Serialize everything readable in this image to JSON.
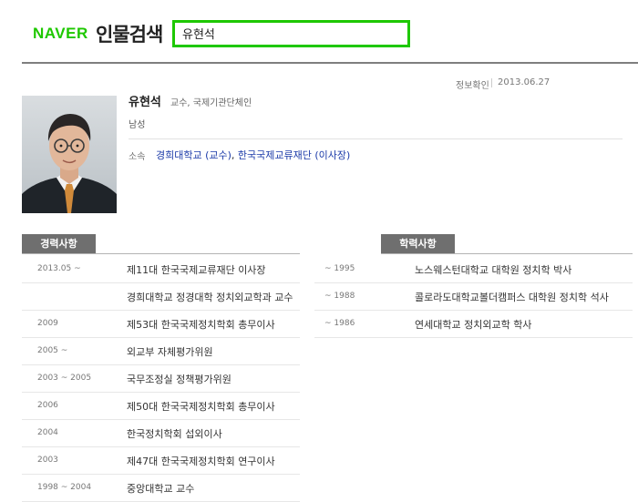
{
  "header": {
    "logo": "NAVER",
    "service_name": "인물검색",
    "search_value": "유현석"
  },
  "info": {
    "verify_label": "정보확인",
    "verify_date": "2013.06.27"
  },
  "profile": {
    "name": "유현석",
    "roles": "교수, 국제기관단체인",
    "gender": "남성",
    "affiliation_label": "소속",
    "affiliation_1": "경희대학교 (교수)",
    "affiliation_sep": ", ",
    "affiliation_2": "한국국제교류재단 (이사장)"
  },
  "career": {
    "title": "경력사항",
    "rows": [
      {
        "date": "2013.05 ~",
        "text": "제11대 한국국제교류재단 이사장"
      },
      {
        "date": "",
        "text": "경희대학교 정경대학 정치외교학과 교수"
      },
      {
        "date": "2009",
        "text": "제53대 한국국제정치학회 총무이사"
      },
      {
        "date": "2005 ~",
        "text": "외교부 자체평가위원"
      },
      {
        "date": "2003 ~ 2005",
        "text": "국무조정실 정책평가위원"
      },
      {
        "date": "2006",
        "text": "제50대 한국국제정치학회 총무이사"
      },
      {
        "date": "2004",
        "text": "한국정치학회 섭외이사"
      },
      {
        "date": "2003",
        "text": "제47대 한국국제정치학회 연구이사"
      },
      {
        "date": "1998 ~ 2004",
        "text": "중앙대학교 교수"
      }
    ]
  },
  "education": {
    "title": "학력사항",
    "rows": [
      {
        "date": "~ 1995",
        "text": "노스웨스턴대학교 대학원 정치학 박사"
      },
      {
        "date": "~ 1988",
        "text": "콜로라도대학교볼더캠퍼스 대학원 정치학 석사"
      },
      {
        "date": "~ 1986",
        "text": "연세대학교 정치외교학 학사"
      }
    ]
  },
  "colors": {
    "brand_green": "#1ec800",
    "tab_gray": "#6f6f6f",
    "link_blue": "#1b3aa8"
  }
}
